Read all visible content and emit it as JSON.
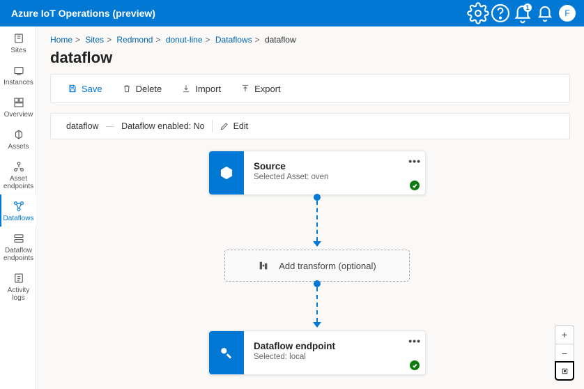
{
  "app_title": "Azure IoT Operations (preview)",
  "notification_count": "1",
  "avatar_initial": "F",
  "breadcrumb": [
    "Home",
    "Sites",
    "Redmond",
    "donut-line",
    "Dataflows",
    "dataflow"
  ],
  "page_title": "dataflow",
  "toolbar": {
    "save": "Save",
    "delete": "Delete",
    "import": "Import",
    "export": "Export"
  },
  "status": {
    "name": "dataflow",
    "enabled_label": "Dataflow enabled: No",
    "edit": "Edit"
  },
  "sidebar": [
    {
      "label": "Sites"
    },
    {
      "label": "Instances"
    },
    {
      "label": "Overview"
    },
    {
      "label": "Assets"
    },
    {
      "label": "Asset endpoints"
    },
    {
      "label": "Dataflows"
    },
    {
      "label": "Dataflow endpoints"
    },
    {
      "label": "Activity logs"
    }
  ],
  "flow": {
    "source": {
      "title": "Source",
      "subtitle": "Selected Asset: oven"
    },
    "transform_label": "Add transform (optional)",
    "endpoint": {
      "title": "Dataflow endpoint",
      "subtitle": "Selected: local"
    }
  },
  "zoom": {
    "in": "+",
    "out": "−"
  }
}
